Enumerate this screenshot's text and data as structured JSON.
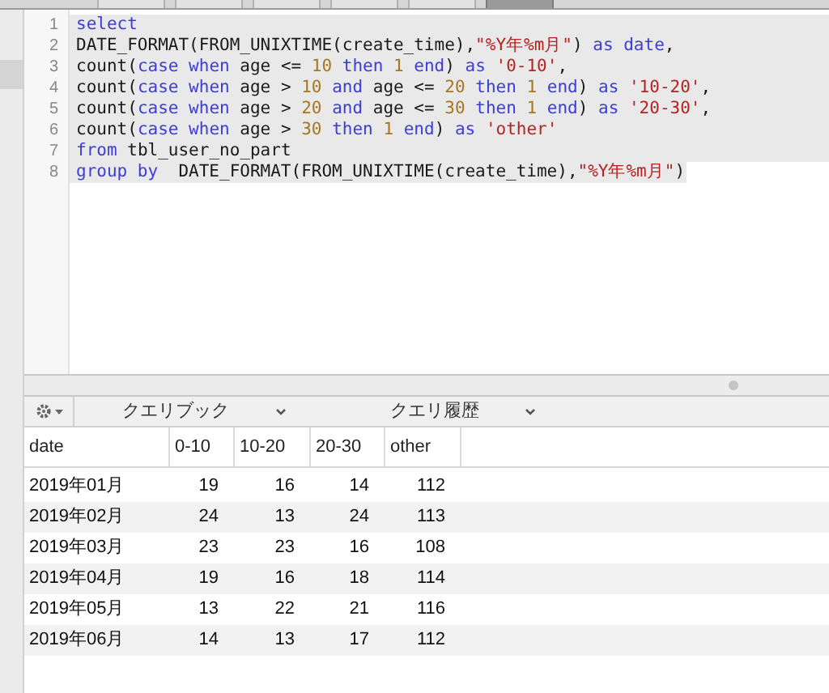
{
  "tab_bar": {
    "tabs": [
      {
        "selected": false
      },
      {
        "selected": false
      },
      {
        "selected": false
      },
      {
        "selected": false
      },
      {
        "selected": false
      },
      {
        "selected": true
      }
    ]
  },
  "editor": {
    "lines": [
      {
        "number": "1",
        "selected": true,
        "tokens": [
          {
            "text": "select",
            "kind": "keyword"
          }
        ]
      },
      {
        "number": "2",
        "selected": true,
        "tokens": [
          {
            "text": "DATE_FORMAT(FROM_UNIXTIME(create_time),",
            "kind": "plain"
          },
          {
            "text": "\"%Y年%m月\"",
            "kind": "string"
          },
          {
            "text": ") ",
            "kind": "plain"
          },
          {
            "text": "as date",
            "kind": "keyword"
          },
          {
            "text": ",",
            "kind": "plain"
          }
        ]
      },
      {
        "number": "3",
        "selected": true,
        "tokens": [
          {
            "text": "count(",
            "kind": "plain"
          },
          {
            "text": "case when",
            "kind": "keyword"
          },
          {
            "text": " age <= ",
            "kind": "plain"
          },
          {
            "text": "10",
            "kind": "number"
          },
          {
            "text": " then ",
            "kind": "keyword"
          },
          {
            "text": "1",
            "kind": "number"
          },
          {
            "text": " end",
            "kind": "keyword"
          },
          {
            "text": ") ",
            "kind": "plain"
          },
          {
            "text": "as ",
            "kind": "keyword"
          },
          {
            "text": "'0-10'",
            "kind": "string"
          },
          {
            "text": ",",
            "kind": "plain"
          }
        ]
      },
      {
        "number": "4",
        "selected": true,
        "tokens": [
          {
            "text": "count(",
            "kind": "plain"
          },
          {
            "text": "case when",
            "kind": "keyword"
          },
          {
            "text": " age > ",
            "kind": "plain"
          },
          {
            "text": "10",
            "kind": "number"
          },
          {
            "text": " and",
            "kind": "keyword"
          },
          {
            "text": " age <= ",
            "kind": "plain"
          },
          {
            "text": "20",
            "kind": "number"
          },
          {
            "text": " then ",
            "kind": "keyword"
          },
          {
            "text": "1",
            "kind": "number"
          },
          {
            "text": " end",
            "kind": "keyword"
          },
          {
            "text": ") ",
            "kind": "plain"
          },
          {
            "text": "as ",
            "kind": "keyword"
          },
          {
            "text": "'10-20'",
            "kind": "string"
          },
          {
            "text": ",",
            "kind": "plain"
          }
        ]
      },
      {
        "number": "5",
        "selected": true,
        "tokens": [
          {
            "text": "count(",
            "kind": "plain"
          },
          {
            "text": "case when",
            "kind": "keyword"
          },
          {
            "text": " age > ",
            "kind": "plain"
          },
          {
            "text": "20",
            "kind": "number"
          },
          {
            "text": " and",
            "kind": "keyword"
          },
          {
            "text": " age <= ",
            "kind": "plain"
          },
          {
            "text": "30",
            "kind": "number"
          },
          {
            "text": " then ",
            "kind": "keyword"
          },
          {
            "text": "1",
            "kind": "number"
          },
          {
            "text": " end",
            "kind": "keyword"
          },
          {
            "text": ") ",
            "kind": "plain"
          },
          {
            "text": "as ",
            "kind": "keyword"
          },
          {
            "text": "'20-30'",
            "kind": "string"
          },
          {
            "text": ",",
            "kind": "plain"
          }
        ]
      },
      {
        "number": "6",
        "selected": true,
        "tokens": [
          {
            "text": "count(",
            "kind": "plain"
          },
          {
            "text": "case when",
            "kind": "keyword"
          },
          {
            "text": " age > ",
            "kind": "plain"
          },
          {
            "text": "30",
            "kind": "number"
          },
          {
            "text": " then ",
            "kind": "keyword"
          },
          {
            "text": "1",
            "kind": "number"
          },
          {
            "text": " end",
            "kind": "keyword"
          },
          {
            "text": ") ",
            "kind": "plain"
          },
          {
            "text": "as ",
            "kind": "keyword"
          },
          {
            "text": "'other'",
            "kind": "string"
          }
        ]
      },
      {
        "number": "7",
        "selected": true,
        "tokens": [
          {
            "text": "from",
            "kind": "keyword"
          },
          {
            "text": " tbl_user_no_part",
            "kind": "plain"
          }
        ]
      },
      {
        "number": "8",
        "selected": true,
        "tokens": [
          {
            "text": "group by",
            "kind": "keyword"
          },
          {
            "text": "  DATE_FORMAT(FROM_UNIXTIME(create_time),",
            "kind": "plain"
          },
          {
            "text": "\"%Y年%m月\"",
            "kind": "string"
          },
          {
            "text": ")",
            "kind": "plain"
          }
        ]
      }
    ]
  },
  "toolbar": {
    "dropdowns": [
      "クエリブック",
      "クエリ履歴"
    ]
  },
  "table": {
    "columns": [
      "date",
      "0-10",
      "10-20",
      "20-30",
      "other"
    ],
    "rows": [
      [
        "2019年01月",
        "19",
        "16",
        "14",
        "112"
      ],
      [
        "2019年02月",
        "24",
        "13",
        "24",
        "113"
      ],
      [
        "2019年03月",
        "23",
        "23",
        "16",
        "108"
      ],
      [
        "2019年04月",
        "19",
        "16",
        "18",
        "114"
      ],
      [
        "2019年05月",
        "13",
        "22",
        "21",
        "116"
      ],
      [
        "2019年06月",
        "14",
        "13",
        "17",
        "112"
      ]
    ]
  }
}
